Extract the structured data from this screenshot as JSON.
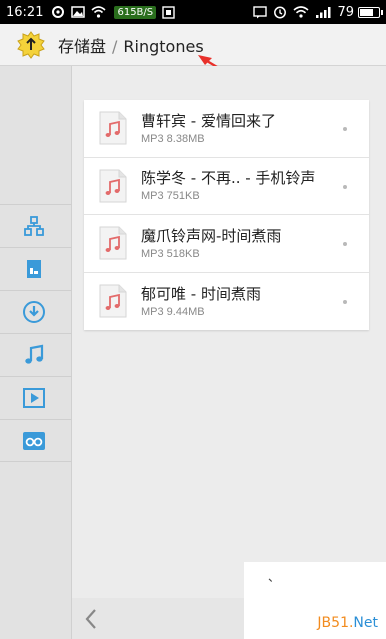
{
  "status_bar": {
    "time": "16:21",
    "net_speed": "615B/S",
    "battery": "79",
    "battery_level": 0.79,
    "icons": [
      "sync-icon",
      "image-icon",
      "wifi-icon",
      "screenshot-icon",
      "alarm-icon",
      "wifi-icon",
      "signal-icon",
      "battery-icon"
    ]
  },
  "header": {
    "root": "存储盘",
    "separator": "/",
    "current": "Ringtones"
  },
  "sidebar": {
    "items": [
      {
        "icon": "network-icon"
      },
      {
        "icon": "sd-card-icon"
      },
      {
        "icon": "download-icon"
      },
      {
        "icon": "music-icon"
      },
      {
        "icon": "video-icon"
      },
      {
        "icon": "glasses-icon"
      }
    ]
  },
  "files": [
    {
      "name": "曹轩宾 - 爱情回来了",
      "meta": "MP3 8.38MB"
    },
    {
      "name": "陈学冬 - 不再.. - 手机铃声",
      "meta": "MP3 751KB"
    },
    {
      "name": "魔爪铃声网-时间煮雨",
      "meta": "MP3 518KB"
    },
    {
      "name": "郁可唯 - 时间煮雨",
      "meta": "MP3 9.44MB"
    }
  ],
  "watermark": {
    "brand": "JB51.",
    "suffix": "Net",
    "mark": "、"
  },
  "colors": {
    "accent": "#3a9ad9",
    "music_icon": "#e36b6b",
    "annotation": "#e8302a"
  }
}
